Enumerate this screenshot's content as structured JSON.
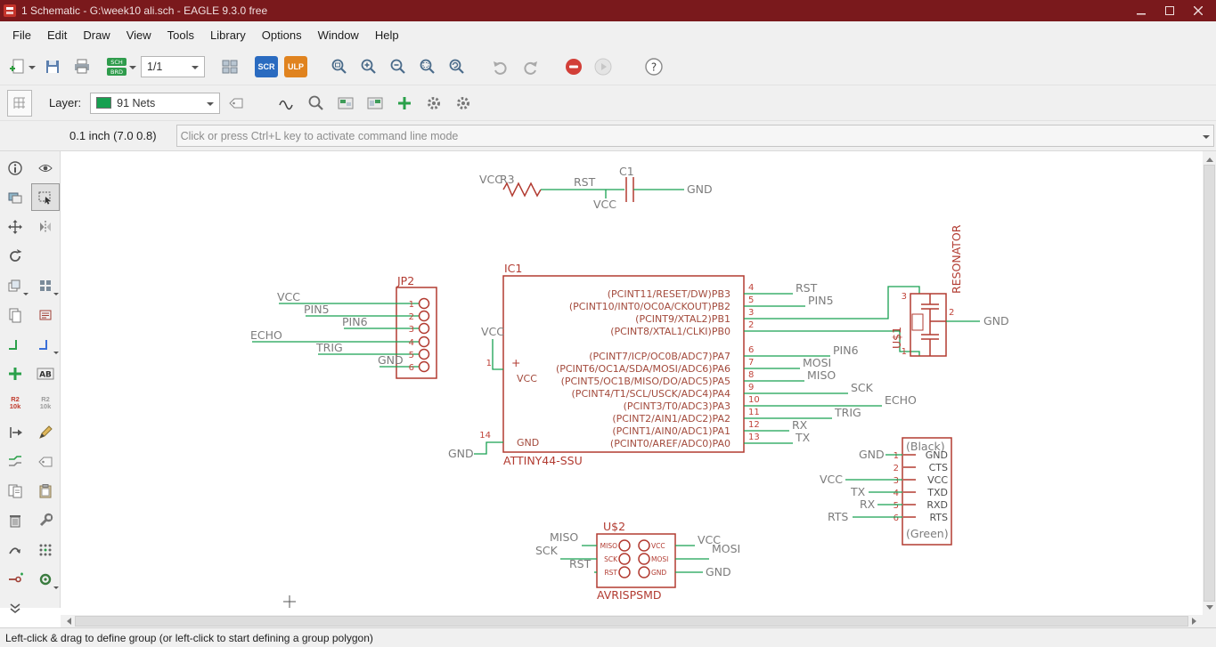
{
  "window": {
    "title": "1 Schematic - G:\\week10 ali.sch - EAGLE 9.3.0 free"
  },
  "menubar": {
    "items": [
      "File",
      "Edit",
      "Draw",
      "View",
      "Tools",
      "Library",
      "Options",
      "Window",
      "Help"
    ]
  },
  "toolbar": {
    "sheet_select": "1/1",
    "sch_label": "SCH",
    "brd_label": "BRD",
    "scr_label": "SCR",
    "ulp_label": "ULP",
    "help_glyph": "?"
  },
  "layerbar": {
    "layer_label": "Layer:",
    "layer_value": "91 Nets",
    "layer_color": "#17a050"
  },
  "commandbar": {
    "coordinates": "0.1 inch (7.0 0.8)",
    "placeholder": "Click or press Ctrl+L key to activate command line mode"
  },
  "statusbar": {
    "text": "Left-click & drag to define group (or left-click to start defining a group polygon)"
  },
  "sidebar": {
    "text_tool": "AB",
    "part_top": "R2",
    "part_bottom": "10k"
  },
  "schematic": {
    "rc": {
      "vcc_left": "VCC",
      "r_name": "R3",
      "rst": "RST",
      "c_name": "C1",
      "gnd": "GND",
      "vcc_below": "VCC"
    },
    "jp2": {
      "name": "JP2",
      "nets": [
        "VCC",
        "PIN5",
        "PIN6",
        "ECHO",
        "TRIG",
        "GND"
      ],
      "pins": [
        "1",
        "2",
        "3",
        "4",
        "5",
        "6"
      ]
    },
    "ic1": {
      "name": "IC1",
      "value": "ATTINY44-SSU",
      "left": {
        "vcc_net": "VCC",
        "pin1": "1",
        "plus": "+",
        "pin1_name": "VCC",
        "gnd_net": "GND",
        "pin14": "14",
        "pin14_name": "GND"
      },
      "right_pins": [
        {
          "num": "4",
          "name": "(PCINT11/RESET/DW)PB3",
          "net": "RST"
        },
        {
          "num": "5",
          "name": "(PCINT10/INT0/OC0A/CKOUT)PB2",
          "net": "PIN5"
        },
        {
          "num": "3",
          "name": "(PCINT9/XTAL2)PB1",
          "net": ""
        },
        {
          "num": "2",
          "name": "(PCINT8/XTAL1/CLKI)PB0",
          "net": ""
        },
        {
          "num": "6",
          "name": "(PCINT7/ICP/OC0B/ADC7)PA7",
          "net": "PIN6"
        },
        {
          "num": "7",
          "name": "(PCINT6/OC1A/SDA/MOSI/ADC6)PA6",
          "net": "MOSI"
        },
        {
          "num": "8",
          "name": "(PCINT5/OC1B/MISO/DO/ADC5)PA5",
          "net": "MISO"
        },
        {
          "num": "9",
          "name": "(PCINT4/T1/SCL/USCK/ADC4)PA4",
          "net": "SCK"
        },
        {
          "num": "10",
          "name": "(PCINT3/T0/ADC3)PA3",
          "net": "ECHO"
        },
        {
          "num": "11",
          "name": "(PCINT2/AIN1/ADC2)PA2",
          "net": "TRIG"
        },
        {
          "num": "12",
          "name": "(PCINT1/AIN0/ADC1)PA1",
          "net": "RX"
        },
        {
          "num": "13",
          "name": "(PCINT0/AREF/ADC0)PA0",
          "net": "TX"
        }
      ]
    },
    "resonator": {
      "label": "RESONATOR",
      "name": "U$1",
      "pin3": "3",
      "pin1": "1",
      "pin2": "2",
      "gnd": "GND"
    },
    "ftdi": {
      "top": "(Black)",
      "bottom": "(Green)",
      "pin_names": [
        "GND",
        "CTS",
        "VCC",
        "TXD",
        "RXD",
        "RTS"
      ],
      "pin_nums": [
        "1",
        "2",
        "3",
        "4",
        "5",
        "6"
      ],
      "nets": {
        "gnd": "GND",
        "vcc": "VCC",
        "tx": "TX",
        "rx": "RX",
        "rts": "RTS"
      }
    },
    "isp": {
      "name": "U$2",
      "value": "AVRISPSMD",
      "left_pins": [
        "MISO",
        "SCK",
        "RST"
      ],
      "right_pins": [
        "VCC",
        "MOSI",
        "GND"
      ],
      "left_nets": [
        "MISO",
        "SCK",
        "RST"
      ],
      "right_nets": [
        "VCC",
        "MOSI",
        "GND"
      ]
    }
  }
}
